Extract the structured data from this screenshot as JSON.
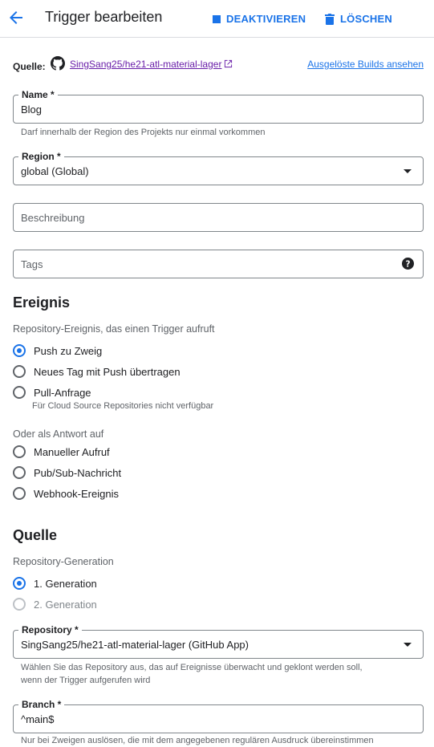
{
  "header": {
    "title": "Trigger bearbeiten",
    "deactivate_label": "DEAKTIVIEREN",
    "delete_label": "LÖSCHEN"
  },
  "source": {
    "label": "Quelle:",
    "repo": "SingSang25/he21-atl-material-lager",
    "builds_link": "Ausgelöste Builds ansehen"
  },
  "name_field": {
    "label": "Name *",
    "value": "Blog",
    "hint": "Darf innerhalb der Region des Projekts nur einmal vorkommen"
  },
  "region_field": {
    "label": "Region *",
    "value": "global (Global)"
  },
  "description_field": {
    "placeholder": "Beschreibung"
  },
  "tags_field": {
    "placeholder": "Tags"
  },
  "event_section": {
    "title": "Ereignis",
    "subtitle": "Repository-Ereignis, das einen Trigger aufruft",
    "options": [
      {
        "label": "Push zu Zweig",
        "checked": true
      },
      {
        "label": "Neues Tag mit Push übertragen",
        "checked": false
      },
      {
        "label": "Pull-Anfrage",
        "checked": false,
        "sub": "Für Cloud Source Repositories nicht verfügbar"
      }
    ],
    "alt_subtitle": "Oder als Antwort auf",
    "alt_options": [
      {
        "label": "Manueller Aufruf"
      },
      {
        "label": "Pub/Sub-Nachricht"
      },
      {
        "label": "Webhook-Ereignis"
      }
    ]
  },
  "source_section": {
    "title": "Quelle",
    "subtitle": "Repository-Generation",
    "generations": [
      {
        "label": "1. Generation",
        "checked": true
      },
      {
        "label": "2. Generation",
        "checked": false,
        "disabled": true
      }
    ],
    "repository_field": {
      "label": "Repository *",
      "value": "SingSang25/he21-atl-material-lager (GitHub App)",
      "hint_line1": "Wählen Sie das Repository aus, das auf Ereignisse überwacht und geklont werden soll,",
      "hint_line2": "wenn der Trigger aufgerufen wird"
    },
    "branch_field": {
      "label": "Branch *",
      "value": "^main$",
      "hint": "Nur bei Zweigen auslösen, die mit dem angegebenen regulären Ausdruck übereinstimmen"
    }
  }
}
